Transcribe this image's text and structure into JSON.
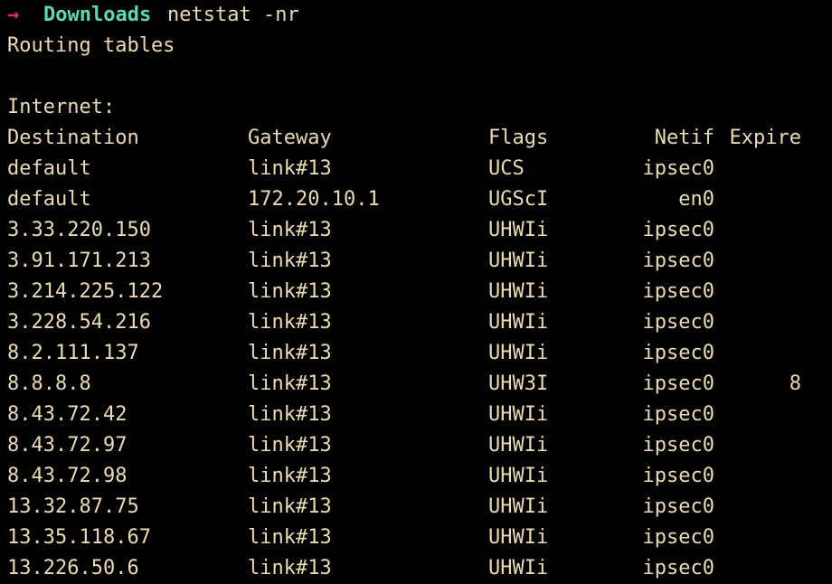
{
  "terminal": {
    "background_color": "#000000",
    "foreground_color": "#EBDBB2",
    "prompt": {
      "arrow_glyph": "→",
      "arrow_color": "#E0257A",
      "directory": "Downloads",
      "directory_color": "#5FD7B0",
      "command": "netstat -nr"
    },
    "output": {
      "heading": "Routing tables",
      "blank_line": "",
      "section": "Internet:",
      "columns": {
        "destination": "Destination",
        "gateway": "Gateway",
        "flags": "Flags",
        "netif": "Netif",
        "expire": "Expire"
      },
      "rows": [
        {
          "destination": "default",
          "gateway": "link#13",
          "flags": "UCS",
          "netif": "ipsec0",
          "expire": ""
        },
        {
          "destination": "default",
          "gateway": "172.20.10.1",
          "flags": "UGScI",
          "netif": "en0",
          "expire": ""
        },
        {
          "destination": "3.33.220.150",
          "gateway": "link#13",
          "flags": "UHWIi",
          "netif": "ipsec0",
          "expire": ""
        },
        {
          "destination": "3.91.171.213",
          "gateway": "link#13",
          "flags": "UHWIi",
          "netif": "ipsec0",
          "expire": ""
        },
        {
          "destination": "3.214.225.122",
          "gateway": "link#13",
          "flags": "UHWIi",
          "netif": "ipsec0",
          "expire": ""
        },
        {
          "destination": "3.228.54.216",
          "gateway": "link#13",
          "flags": "UHWIi",
          "netif": "ipsec0",
          "expire": ""
        },
        {
          "destination": "8.2.111.137",
          "gateway": "link#13",
          "flags": "UHWIi",
          "netif": "ipsec0",
          "expire": ""
        },
        {
          "destination": "8.8.8.8",
          "gateway": "link#13",
          "flags": "UHW3I",
          "netif": "ipsec0",
          "expire": "8"
        },
        {
          "destination": "8.43.72.42",
          "gateway": "link#13",
          "flags": "UHWIi",
          "netif": "ipsec0",
          "expire": ""
        },
        {
          "destination": "8.43.72.97",
          "gateway": "link#13",
          "flags": "UHWIi",
          "netif": "ipsec0",
          "expire": ""
        },
        {
          "destination": "8.43.72.98",
          "gateway": "link#13",
          "flags": "UHWIi",
          "netif": "ipsec0",
          "expire": ""
        },
        {
          "destination": "13.32.87.75",
          "gateway": "link#13",
          "flags": "UHWIi",
          "netif": "ipsec0",
          "expire": ""
        },
        {
          "destination": "13.35.118.67",
          "gateway": "link#13",
          "flags": "UHWIi",
          "netif": "ipsec0",
          "expire": ""
        },
        {
          "destination": "13.226.50.6",
          "gateway": "link#13",
          "flags": "UHWIi",
          "netif": "ipsec0",
          "expire": ""
        }
      ]
    }
  }
}
